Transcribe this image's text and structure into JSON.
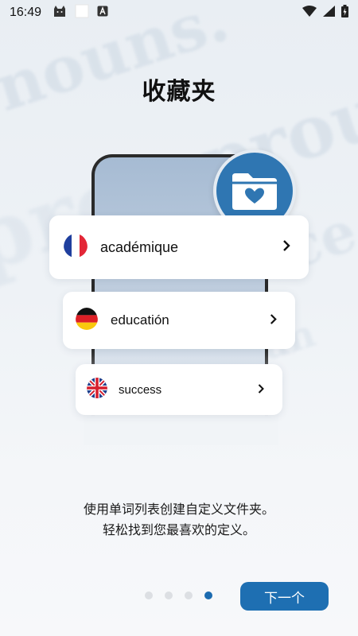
{
  "status_bar": {
    "time": "16:49",
    "icons": [
      "cat-notification-icon",
      "white-square-icon",
      "a-box-icon",
      "wifi-icon",
      "signal-icon",
      "battery-charging-icon"
    ]
  },
  "background_words": [
    "nouns.",
    "prou",
    "pro",
    "ce",
    "an"
  ],
  "title": "收藏夹",
  "folder_icon": "folder-heart-icon",
  "word_cards": [
    {
      "flag": "france-flag-icon",
      "word": "académique"
    },
    {
      "flag": "germany-flag-icon",
      "word": "educatión"
    },
    {
      "flag": "uk-flag-icon",
      "word": "success"
    }
  ],
  "description": {
    "line1": "使用单词列表创建自定义文件夹。",
    "line2": "轻松找到您最喜欢的定义。"
  },
  "pagination": {
    "total": 4,
    "active_index": 3
  },
  "next_button_label": "下一个",
  "colors": {
    "accent": "#1e6fb2",
    "badge": "#2f76b2",
    "dot_inactive": "#dcdfe3"
  }
}
